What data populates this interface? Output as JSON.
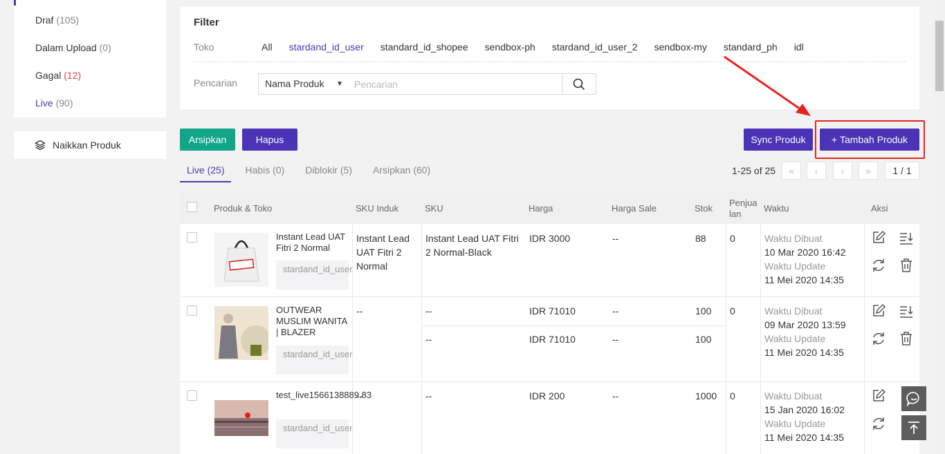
{
  "sidebar": {
    "status_items": [
      {
        "label": "Draf",
        "count": "(105)"
      },
      {
        "label": "Dalam Upload",
        "count": "(0)"
      },
      {
        "label": "Gagal",
        "count": "(12)"
      },
      {
        "label": "Live",
        "count": "(90)"
      }
    ],
    "naikkan_label": "Naikkan Produk"
  },
  "filter": {
    "title": "Filter",
    "toko_label": "Toko",
    "toko_options": [
      "All",
      "stardand_id_user",
      "standard_id_shopee",
      "sendbox-ph",
      "stardand_id_user_2",
      "sendbox-my",
      "standard_ph",
      "idl"
    ],
    "search_label": "Pencarian",
    "search_field_select": "Nama Produk",
    "search_placeholder": "Pencarian"
  },
  "actions": {
    "arsipkan": "Arsipkan",
    "hapus": "Hapus",
    "sync": "Sync Produk",
    "tambah": "Tambah Produk"
  },
  "tabs": [
    {
      "label": "Live",
      "count": "(25)"
    },
    {
      "label": "Habis",
      "count": "(0)"
    },
    {
      "label": "Diblokir",
      "count": "(5)"
    },
    {
      "label": "Arsipkan",
      "count": "(60)"
    }
  ],
  "pagination": {
    "info": "1-25 of 25",
    "page": "1 / 1"
  },
  "table": {
    "headers": {
      "produk": "Produk & Toko",
      "sku_induk": "SKU Induk",
      "sku": "SKU",
      "harga": "Harga",
      "harga_sale": "Harga Sale",
      "stok": "Stok",
      "penjualan_1": "Penjua",
      "penjualan_2": "lan",
      "waktu": "Waktu",
      "aksi": "Aksi"
    },
    "rows": [
      {
        "name": "Instant Lead UAT Fitri 2 Normal",
        "store": "stardand_id_user",
        "sku_induk": "Instant Lead UAT Fitri 2 Normal",
        "sku": "Instant Lead UAT Fitri 2 Normal-Black",
        "harga": "IDR 3000",
        "harga_sale": "--",
        "stok": "88",
        "penjualan": "0",
        "dibuat_label": "Waktu Dibuat",
        "dibuat": "10 Mar 2020 16:42",
        "update_label": "Waktu Update",
        "update": "11 Mei 2020 14:35"
      },
      {
        "name": "OUTWEAR MUSLIM WANITA | BLAZER WANIT...",
        "store": "stardand_id_user",
        "sku_induk": "--",
        "variants": [
          {
            "sku": "--",
            "harga": "IDR 71010",
            "harga_sale": "--",
            "stok": "100"
          },
          {
            "sku": "--",
            "harga": "IDR 71010",
            "harga_sale": "--",
            "stok": "100"
          }
        ],
        "penjualan": "0",
        "dibuat_label": "Waktu Dibuat",
        "dibuat": "09 Mar 2020 13:59",
        "update_label": "Waktu Update",
        "update": "11 Mei 2020 14:35"
      },
      {
        "name": "test_live1566138889.83",
        "store": "stardand_id_user",
        "sku_induk": "--",
        "sku": "--",
        "harga": "IDR 200",
        "harga_sale": "--",
        "stok": "1000",
        "penjualan": "0",
        "dibuat_label": "Waktu Dibuat",
        "dibuat": "15 Jan 2020 16:02",
        "update_label": "Waktu Update",
        "update": "11 Mei 2020 14:35"
      }
    ]
  },
  "colors": {
    "accent": "#4a3aad",
    "button_purple": "#4a33b5",
    "button_green": "#11a58a",
    "danger": "#e64340",
    "highlight": "#e8221d"
  }
}
